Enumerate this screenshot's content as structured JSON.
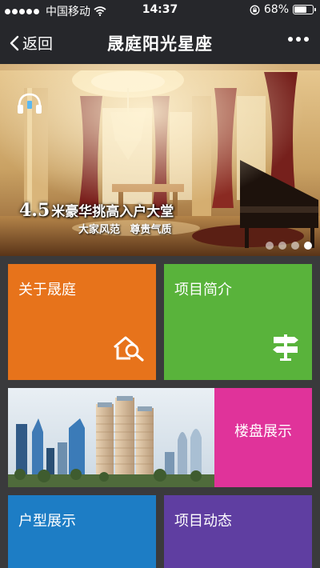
{
  "status_bar": {
    "carrier": "中国移动",
    "time": "14:37",
    "battery_text": "68%",
    "battery_level": 0.68
  },
  "nav": {
    "back_label": "返回",
    "title": "晟庭阳光星座"
  },
  "banner": {
    "headline_number": "4.5",
    "headline_text": "米豪华挑高入户大堂",
    "subtitle": "大家风范 尊贵气质",
    "slide_count": 4,
    "active_slide": 4
  },
  "tiles": {
    "about": {
      "label": "关于晟庭",
      "color": "#e7731b",
      "icon": "house-search-icon"
    },
    "intro": {
      "label": "项目简介",
      "color": "#59b33b",
      "icon": "signpost-icon"
    },
    "buildings": {
      "label": "楼盘展示",
      "color": "#e0339a"
    },
    "floorplans": {
      "label": "户型展示",
      "color": "#1d7dc5"
    },
    "news": {
      "label": "项目动态",
      "color": "#5f3ea1"
    }
  }
}
